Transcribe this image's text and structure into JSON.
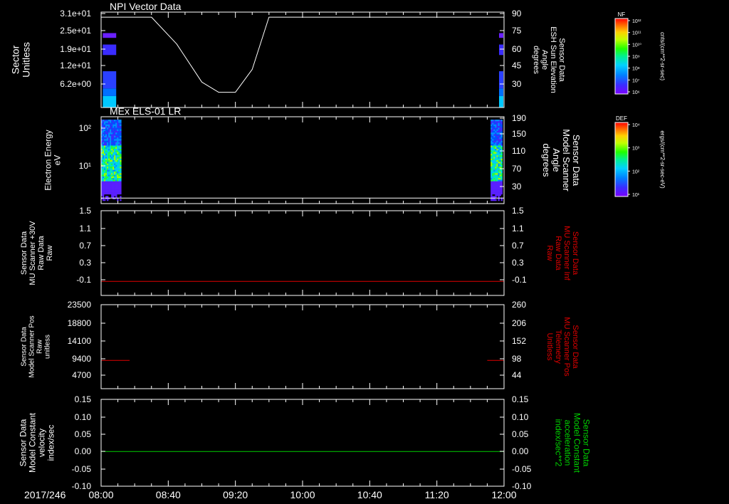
{
  "colors": {
    "background": "#000000",
    "axis": "#ffffff",
    "red_trace": "#e00000",
    "green_trace": "#00d000",
    "spectrum": [
      "#7a00ff",
      "#3a2cff",
      "#0070ff",
      "#00b4ff",
      "#00e0b0",
      "#00f000",
      "#a0ff00",
      "#ffff00",
      "#ffa000",
      "#ff3000",
      "#ff0000"
    ]
  },
  "time_axis": {
    "date_label": "2017/246",
    "start": "08:00",
    "end": "12:00",
    "tick_labels": [
      "08:00",
      "08:40",
      "09:20",
      "10:00",
      "10:40",
      "11:20",
      "12:00"
    ]
  },
  "panels": [
    {
      "id": "p1",
      "title": "NPI Vector Data",
      "left_label": [
        "Sector",
        "Unitless"
      ],
      "left_ticks": [
        "3.1e+01",
        "2.5e+01",
        "1.9e+01",
        "1.2e+01",
        "6.2e+00"
      ],
      "right_label": [
        "Sensor Data",
        "ESH Sun Elevation",
        "Angle",
        "degrees"
      ],
      "right_ticks": [
        "90",
        "75",
        "60",
        "45",
        "30"
      ],
      "colorbar": {
        "title": "NF",
        "unit": "cnts/(cm**2-sr-sec)",
        "tick_labels": [
          "10¹²",
          "10¹¹",
          "10¹⁰",
          "10⁹",
          "10⁸",
          "10⁷",
          "10⁶"
        ]
      }
    },
    {
      "id": "p2",
      "title": "MEx ELS-01 LR",
      "left_label": [
        "Electron Energy",
        "eV"
      ],
      "left_ticks": [
        "10²",
        "10¹"
      ],
      "right_label": [
        "Sensor Data",
        "Model Scanner",
        "Angle",
        "degrees"
      ],
      "right_ticks": [
        "190",
        "150",
        "110",
        "70",
        "30"
      ],
      "colorbar": {
        "title": "DEF",
        "unit": "ergs/(cm**2-sr-sec-eV)",
        "tick_labels": [
          "10⁴",
          "10³",
          "10²",
          "10¹"
        ]
      }
    },
    {
      "id": "p3",
      "left_label": [
        "Sensor Data",
        "MU Scanner +30V",
        "Raw Data",
        "Raw"
      ],
      "left_ticks": [
        "1.5",
        "1.1",
        "0.7",
        "0.3",
        "-0.1"
      ],
      "right_label": [
        "Sensor Data",
        "MU Scanner Inf",
        "Raw Data",
        "Raw"
      ],
      "right_ticks": [
        "1.5",
        "1.1",
        "0.7",
        "0.3",
        "-0.1"
      ]
    },
    {
      "id": "p4",
      "left_label": [
        "Sensor Data",
        "Model Scanner Pos",
        "Raw",
        "unitless"
      ],
      "left_ticks": [
        "23500",
        "18800",
        "14100",
        "9400",
        "4700"
      ],
      "right_label": [
        "Sensor Data",
        "MU Scanner Pos",
        "Telemetry",
        "Unitless"
      ],
      "right_ticks": [
        "260",
        "206",
        "152",
        "98",
        "44"
      ]
    },
    {
      "id": "p5",
      "left_label": [
        "Sensor Data",
        "Model Constant",
        "velocity",
        "index/sec"
      ],
      "left_ticks": [
        "0.15",
        "0.10",
        "0.05",
        "0.00",
        "-0.05",
        "-0.10"
      ],
      "right_label": [
        "Sensor Data",
        "Model Constant",
        "acceleration",
        "index/sec**2"
      ],
      "right_ticks": [
        "0.15",
        "0.10",
        "0.05",
        "0.00",
        "-0.05",
        "-0.10"
      ]
    }
  ],
  "chart_data": [
    {
      "type": "heatmap",
      "panel": "p1",
      "title": "NPI Vector Data",
      "ylabel": "Sector Unitless",
      "x_range": [
        "08:00",
        "12:00"
      ],
      "active_intervals": [
        [
          "08:01",
          "08:09"
        ],
        [
          "11:51",
          "11:59"
        ]
      ],
      "overlay_line": {
        "name": "ESH Sun Elevation Angle",
        "x": [
          "08:00",
          "08:30",
          "08:45",
          "09:00",
          "09:10",
          "09:20",
          "09:30",
          "09:40",
          "12:00"
        ],
        "y": [
          86,
          86,
          65,
          35,
          27,
          27,
          45,
          86,
          86
        ],
        "ylim": [
          15,
          90
        ]
      }
    },
    {
      "type": "heatmap",
      "panel": "p2",
      "title": "MEx ELS-01 LR",
      "ylabel": "Electron Energy eV",
      "x_range": [
        "08:00",
        "12:00"
      ],
      "active_intervals": [
        [
          "08:00",
          "08:12"
        ],
        [
          "11:52",
          "11:59"
        ]
      ],
      "overlay_line": {
        "name": "Model Scanner Angle",
        "x": [
          "08:00",
          "12:00"
        ],
        "y": [
          12,
          12
        ],
        "ylim": [
          0,
          190
        ]
      }
    },
    {
      "type": "line",
      "panel": "p3",
      "series": [
        {
          "name": "MU Scanner Inf Raw Data",
          "x": [
            "08:00",
            "12:00"
          ],
          "y": [
            0.0,
            0.0
          ]
        }
      ],
      "ylim": [
        -0.3,
        1.5
      ]
    },
    {
      "type": "line",
      "panel": "p4",
      "series": [
        {
          "name": "MU Scanner Pos Telemetry",
          "x": [
            "08:00",
            "08:17"
          ],
          "y": [
            7900,
            7900
          ]
        },
        {
          "name": "MU Scanner Pos Telemetry",
          "x": [
            "11:50",
            "12:00"
          ],
          "y": [
            7900,
            7900
          ]
        }
      ],
      "ylim": [
        0,
        23500
      ]
    },
    {
      "type": "line",
      "panel": "p5",
      "series": [
        {
          "name": "Model Constant acceleration",
          "x": [
            "08:00",
            "12:00"
          ],
          "y": [
            0.0,
            0.0
          ]
        }
      ],
      "ylim": [
        -0.1,
        0.15
      ]
    }
  ]
}
